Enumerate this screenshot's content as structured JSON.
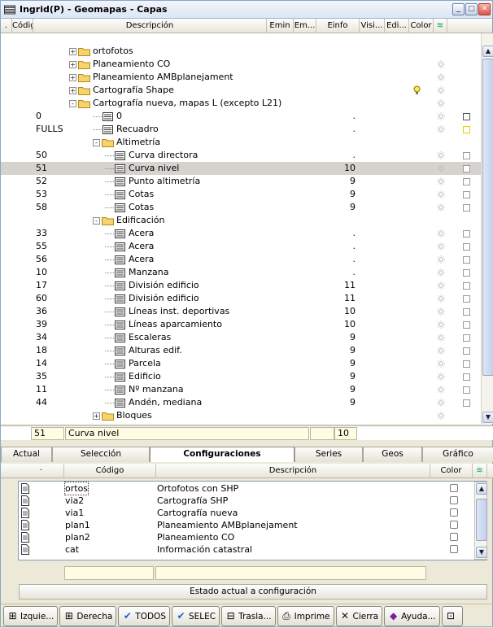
{
  "window": {
    "title": "Ingrid(P) - Geomapas - Capas",
    "controls": [
      "_",
      "□",
      "✕"
    ]
  },
  "layers_grid": {
    "columns": {
      "dot": ".",
      "code": "Código",
      "desc": "Descripción",
      "emin": "Emin",
      "em": "Em...",
      "einfo": "Einfo",
      "visi": "Visi...",
      "edi": "Edi...",
      "color": "Color",
      "icon": "≋"
    },
    "rows": [
      {
        "code": "",
        "label": "ortofotos",
        "kind": "folder",
        "level": 0,
        "exp": "+",
        "em": "",
        "sun": false,
        "chk": ""
      },
      {
        "code": "",
        "label": "Planeamiento CO",
        "kind": "folder",
        "level": 0,
        "exp": "+",
        "em": "",
        "sun": true,
        "chk": ""
      },
      {
        "code": "",
        "label": "Planeamiento AMBplanejament",
        "kind": "folder",
        "level": 0,
        "exp": "+",
        "em": "",
        "sun": true,
        "chk": ""
      },
      {
        "code": "",
        "label": "Cartografía Shape",
        "kind": "folder",
        "level": 0,
        "exp": "+",
        "em": "",
        "sun": true,
        "chk": "",
        "bulb": true
      },
      {
        "code": "",
        "label": "Cartografía nueva, mapas L (excepto L21)",
        "kind": "folder",
        "level": 0,
        "exp": "-",
        "em": "",
        "sun": true,
        "chk": ""
      },
      {
        "code": "0",
        "label": "0",
        "kind": "layer",
        "level": 1,
        "em": ".",
        "sun": true,
        "chk": "dark"
      },
      {
        "code": "FULLS",
        "label": "Recuadro",
        "kind": "layer",
        "level": 1,
        "em": ".",
        "sun": true,
        "chk": "yel"
      },
      {
        "code": "",
        "label": "Altimetría",
        "kind": "folder",
        "level": 1,
        "exp": "-",
        "em": "",
        "sun": false,
        "chk": ""
      },
      {
        "code": "50",
        "label": "Curva directora",
        "kind": "layer",
        "level": 2,
        "em": ".",
        "sun": true,
        "chk": "dim"
      },
      {
        "code": "51",
        "label": "Curva nivel",
        "kind": "layer",
        "level": 2,
        "em": "10",
        "sun": true,
        "chk": "dim",
        "selected": true
      },
      {
        "code": "52",
        "label": "Punto altimetría",
        "kind": "layer",
        "level": 2,
        "em": "9",
        "sun": true,
        "chk": "dim"
      },
      {
        "code": "53",
        "label": "Cotas",
        "kind": "layer",
        "level": 2,
        "em": "9",
        "sun": true,
        "chk": "dim"
      },
      {
        "code": "58",
        "label": "Cotas",
        "kind": "layer",
        "level": 2,
        "em": "9",
        "sun": true,
        "chk": "dim"
      },
      {
        "code": "",
        "label": "Edificación",
        "kind": "folder",
        "level": 1,
        "exp": "-",
        "em": "",
        "sun": false,
        "chk": ""
      },
      {
        "code": "33",
        "label": "Acera",
        "kind": "layer",
        "level": 2,
        "em": ".",
        "sun": true,
        "chk": "dim"
      },
      {
        "code": "55",
        "label": "Acera",
        "kind": "layer",
        "level": 2,
        "em": ".",
        "sun": true,
        "chk": "dim"
      },
      {
        "code": "56",
        "label": "Acera",
        "kind": "layer",
        "level": 2,
        "em": ".",
        "sun": true,
        "chk": "dim"
      },
      {
        "code": "10",
        "label": "Manzana",
        "kind": "layer",
        "level": 2,
        "em": ".",
        "sun": true,
        "chk": "dim"
      },
      {
        "code": "17",
        "label": "División edificio",
        "kind": "layer",
        "level": 2,
        "em": "11",
        "sun": true,
        "chk": "dim"
      },
      {
        "code": "60",
        "label": "División edificio",
        "kind": "layer",
        "level": 2,
        "em": "11",
        "sun": true,
        "chk": "dim"
      },
      {
        "code": "36",
        "label": "Líneas inst. deportivas",
        "kind": "layer",
        "level": 2,
        "em": "10",
        "sun": true,
        "chk": "dim"
      },
      {
        "code": "39",
        "label": "Líneas aparcamiento",
        "kind": "layer",
        "level": 2,
        "em": "10",
        "sun": true,
        "chk": "dim"
      },
      {
        "code": "34",
        "label": "Escaleras",
        "kind": "layer",
        "level": 2,
        "em": "9",
        "sun": true,
        "chk": "dim"
      },
      {
        "code": "18",
        "label": "Alturas edif.",
        "kind": "layer",
        "level": 2,
        "em": "9",
        "sun": true,
        "chk": "dim"
      },
      {
        "code": "14",
        "label": "Parcela",
        "kind": "layer",
        "level": 2,
        "em": "9",
        "sun": true,
        "chk": "dim"
      },
      {
        "code": "35",
        "label": "Edificio",
        "kind": "layer",
        "level": 2,
        "em": "9",
        "sun": true,
        "chk": "dim"
      },
      {
        "code": "11",
        "label": "Nº manzana",
        "kind": "layer",
        "level": 2,
        "em": "9",
        "sun": true,
        "chk": "dim"
      },
      {
        "code": "44",
        "label": "Andén, mediana",
        "kind": "layer",
        "level": 2,
        "em": "9",
        "sun": true,
        "chk": "dim"
      },
      {
        "code": "",
        "label": "Bloques",
        "kind": "folder",
        "level": 1,
        "exp": "+",
        "em": "",
        "sun": true,
        "chk": ""
      }
    ]
  },
  "edit_row": {
    "code": "51",
    "desc": "Curva nivel",
    "em": "10"
  },
  "tabs": [
    "Actual",
    "Selección",
    "Configuraciones",
    "Series",
    "Geos",
    "Gráfico"
  ],
  "active_tab": "Configuraciones",
  "config_grid": {
    "columns": {
      "dot": "·",
      "code": "Código",
      "desc": "Descripción",
      "color": "Color",
      "icon": "≋"
    },
    "rows": [
      {
        "code": "ortos",
        "desc": "Ortofotos con SHP"
      },
      {
        "code": "via2",
        "desc": "Cartografía SHP"
      },
      {
        "code": "via1",
        "desc": "Cartografía nueva"
      },
      {
        "code": "plan1",
        "desc": "Planeamiento AMBplanejament"
      },
      {
        "code": "plan2",
        "desc": "Planeamiento CO"
      },
      {
        "code": "cat",
        "desc": "Información catastral"
      }
    ]
  },
  "estado_button": "Estado actual a configuración",
  "bottom_buttons": [
    {
      "label": "Izquie...",
      "icon": "⊞",
      "name": "izquierda-button"
    },
    {
      "label": "Derecha",
      "icon": "⊞",
      "name": "derecha-button"
    },
    {
      "label": "TODOS",
      "icon": "✔",
      "name": "todos-button"
    },
    {
      "label": "SELEC",
      "icon": "✔",
      "name": "selec-button"
    },
    {
      "label": "Trasla...",
      "icon": "⊟",
      "name": "traslada-button"
    },
    {
      "label": "Imprime",
      "icon": "⎙",
      "name": "imprime-button"
    },
    {
      "label": "Cierra",
      "icon": "✕",
      "name": "cierra-button"
    },
    {
      "label": "Ayuda...",
      "icon": "◆",
      "name": "ayuda-button"
    },
    {
      "label": "",
      "icon": "⊡",
      "name": "extra-button"
    }
  ]
}
